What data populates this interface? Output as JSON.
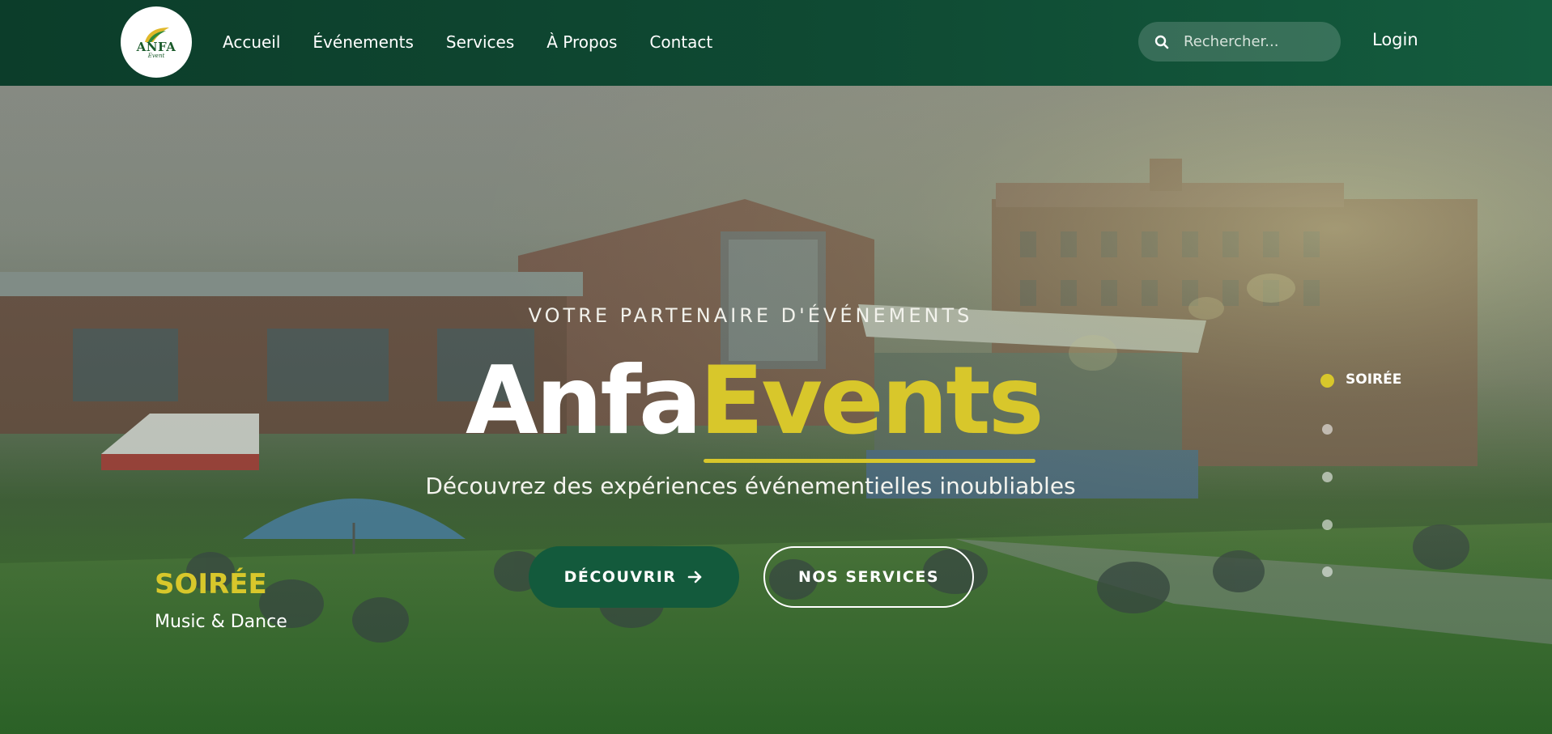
{
  "header": {
    "logo": {
      "title": "ANFA",
      "subtitle": "Event"
    },
    "nav": [
      {
        "label": "Accueil"
      },
      {
        "label": "Événements"
      },
      {
        "label": "Services"
      },
      {
        "label": "À Propos"
      },
      {
        "label": "Contact"
      }
    ],
    "search": {
      "placeholder": "Rechercher..."
    },
    "login_label": "Login"
  },
  "hero": {
    "eyebrow": "VOTRE PARTENAIRE D'ÉVÉNEMENTS",
    "title_part1": "Anfa",
    "title_part2": "Events",
    "subtitle": "Découvrez des expériences événementielles inoubliables",
    "primary_button": "DÉCOUVRIR",
    "secondary_button": "NOS SERVICES",
    "slide": {
      "category": "SOIRÉE",
      "caption": "Music & Dance"
    },
    "slider": {
      "active_label": "SOIRÉE",
      "active_index": 0,
      "count": 5
    }
  },
  "colors": {
    "nav_bg": "#0f4a33",
    "accent_yellow": "#d8c72b",
    "primary_green": "#135a3c"
  },
  "icons": {
    "search": "search-icon",
    "arrow": "arrow-right-icon"
  }
}
